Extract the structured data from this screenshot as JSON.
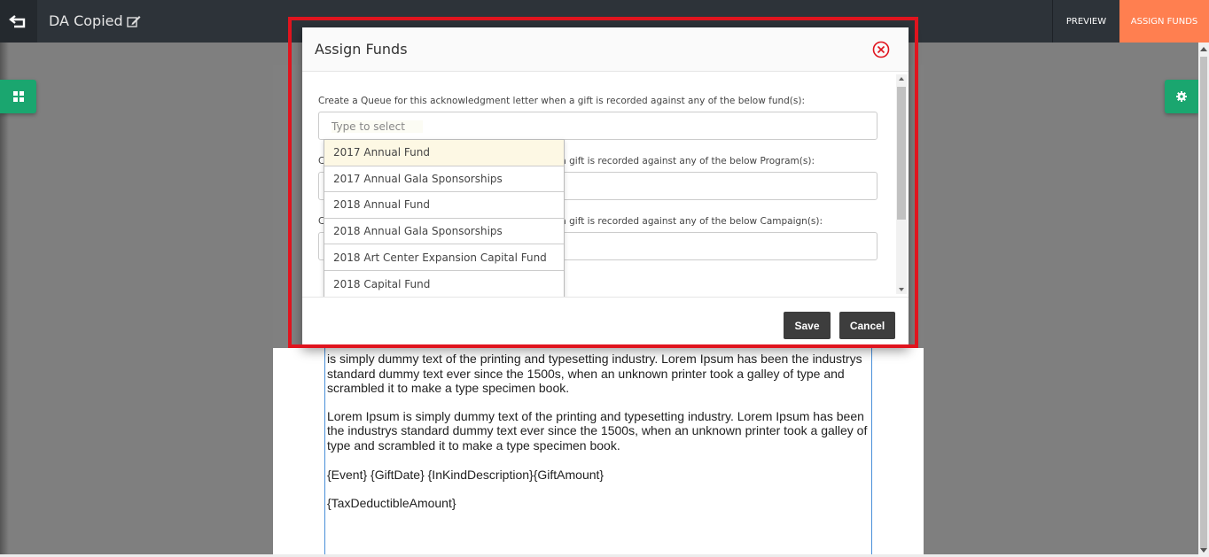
{
  "topbar": {
    "doc_title": "DA Copied",
    "preview_label": "PREVIEW",
    "assign_funds_label": "ASSIGN FUNDS",
    "accent_color": "#ff7f50"
  },
  "editor": {
    "paragraphs": [
      "is simply dummy text of the printing and typesetting industry. Lorem Ipsum has been the industrys standard dummy text ever since the 1500s, when an unknown printer took a galley of type and scrambled it to make a type specimen book.",
      "Lorem Ipsum is simply dummy text of the printing and typesetting industry. Lorem Ipsum has been the industrys standard dummy text ever since the 1500s, when an unknown printer took a galley of type and scrambled it to make a type specimen book.",
      "{Event} {GiftDate} {InKindDescription}{GiftAmount}",
      "{TaxDeductibleAmount}"
    ]
  },
  "modal": {
    "title": "Assign Funds",
    "fund_label": "Create a Queue for this acknowledgment letter when a gift is recorded against any of the below fund(s):",
    "fund_placeholder": "Type to select",
    "program_label_prefix": "C",
    "program_label_suffix": "a gift is recorded against any of the below Program(s):",
    "campaign_label_prefix": "C",
    "campaign_label_suffix": "a gift is recorded against any of the below Campaign(s):",
    "dropdown_options": [
      "2017 Annual Fund",
      "2017 Annual Gala Sponsorships",
      "2018 Annual Fund",
      "2018 Annual Gala Sponsorships",
      "2018 Art Center Expansion Capital Fund",
      "2018 Capital Fund"
    ],
    "save_label": "Save",
    "cancel_label": "Cancel"
  },
  "icons": {
    "back": "back-arrow-icon",
    "edit": "edit-icon",
    "close": "close-circle-icon",
    "left_tab": "grid-icon",
    "right_tab": "gear-icon"
  }
}
